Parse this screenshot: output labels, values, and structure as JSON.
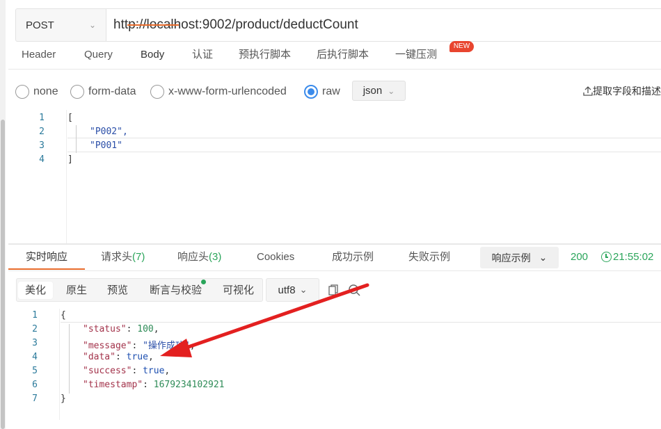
{
  "request": {
    "method": "POST",
    "url": "http://localhost:9002/product/deductCount",
    "tabs": [
      "Header",
      "Query",
      "Body",
      "认证",
      "预执行脚本",
      "后执行脚本",
      "一键压测"
    ],
    "active_tab": "Body",
    "new_badge": "NEW",
    "body_types": [
      "none",
      "form-data",
      "x-www-form-urlencoded",
      "raw"
    ],
    "selected_body_type": "raw",
    "format": "json",
    "extract_label": "提取字段和描述",
    "code_lines": [
      {
        "no": "1",
        "text": "["
      },
      {
        "no": "2",
        "text": "\"P002\","
      },
      {
        "no": "3",
        "text": "\"P001\""
      },
      {
        "no": "4",
        "text": "]"
      }
    ]
  },
  "response": {
    "tabs": {
      "realtime": "实时响应",
      "req_headers": "请求头",
      "req_headers_count": "(7)",
      "resp_headers": "响应头",
      "resp_headers_count": "(3)",
      "cookies": "Cookies",
      "success_example": "成功示例",
      "fail_example": "失败示例"
    },
    "example_select": "响应示例",
    "status_code": "200",
    "time": "21:55:02",
    "views": [
      "美化",
      "原生",
      "预览",
      "断言与校验",
      "可视化"
    ],
    "active_view": "美化",
    "encoding": "utf8",
    "line_numbers": [
      "1",
      "2",
      "3",
      "4",
      "5",
      "6",
      "7"
    ],
    "body": {
      "open": "{",
      "status_key": "\"status\"",
      "status_val": "100",
      "message_key": "\"message\"",
      "message_val": "\"操作成功\"",
      "data_key": "\"data\"",
      "data_val": "true",
      "success_key": "\"success\"",
      "success_val": "true",
      "timestamp_key": "\"timestamp\"",
      "timestamp_val": "1679234102921",
      "close": "}"
    }
  },
  "colors": {
    "accent": "#e86b2b",
    "success": "#2aa55a",
    "radio": "#3b8beb",
    "annotation_arrow": "#e32020"
  }
}
